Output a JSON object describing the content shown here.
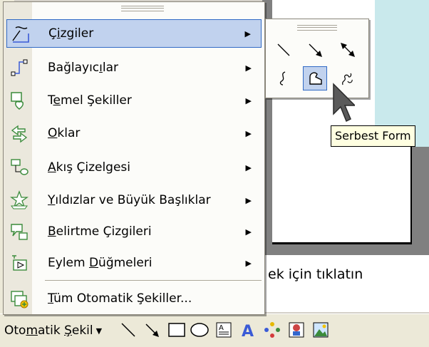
{
  "menu": {
    "items": [
      {
        "label": "Çizgiler",
        "icon": "lines-icon",
        "submenu": true,
        "selected": true
      },
      {
        "label": "Bağlayıcılar",
        "icon": "connectors-icon",
        "submenu": true
      },
      {
        "label": "Temel Şekiller",
        "icon": "basic-shapes-icon",
        "submenu": true
      },
      {
        "label": "Oklar",
        "icon": "block-arrows-icon",
        "submenu": true
      },
      {
        "label": "Akış Çizelgesi",
        "icon": "flowchart-icon",
        "submenu": true
      },
      {
        "label": "Yıldızlar ve Büyük Başlıklar",
        "icon": "stars-banners-icon",
        "submenu": true
      },
      {
        "label": "Belirtme Çizgileri",
        "icon": "callouts-icon",
        "submenu": true
      },
      {
        "label": "Eylem Düğmeleri",
        "icon": "action-buttons-icon",
        "submenu": true
      },
      {
        "label": "Tüm Otomatik Şekiller...",
        "icon": "all-autoshapes-icon",
        "submenu": false
      }
    ]
  },
  "submenu": {
    "tools": [
      "line-icon",
      "arrow-icon",
      "double-arrow-icon",
      "curve-icon",
      "freeform-icon",
      "scribble-icon"
    ],
    "hot_tool": "freeform-icon"
  },
  "tooltip": "Serbest Form",
  "notes_text": "ek için tıklatın",
  "toolbar": {
    "autoshapes_label": "Otomatik Şekil",
    "tools": [
      "line-icon",
      "arrow-icon",
      "rectangle-icon",
      "oval-icon",
      "text-box-icon",
      "wordart-icon",
      "diagram-icon",
      "clip-art-icon",
      "picture-icon"
    ]
  },
  "colors": {
    "selection_fill": "#c1d2ee",
    "selection_border": "#316ac5",
    "tooltip_bg": "#ffffe1",
    "slide_accent": "#c9e9ec"
  }
}
